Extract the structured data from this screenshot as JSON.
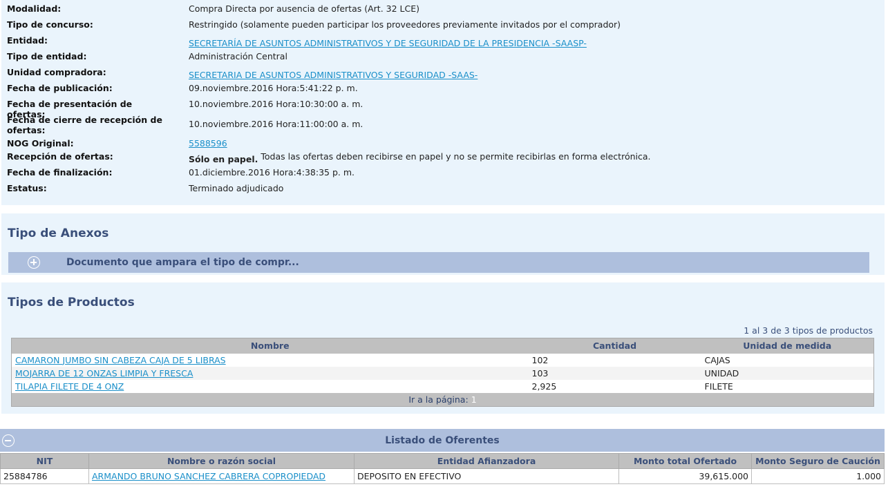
{
  "details": {
    "modalidad_label": "Modalidad:",
    "modalidad_value": "Compra Directa por ausencia de ofertas (Art. 32 LCE)",
    "tipo_concurso_label": "Tipo de concurso:",
    "tipo_concurso_value": "Restringido (solamente pueden participar los proveedores previamente invitados por el comprador)",
    "entidad_label": "Entidad:",
    "entidad_value": "SECRETARÍA DE ASUNTOS ADMINISTRATIVOS Y DE SEGURIDAD DE LA PRESIDENCIA -SAASP-",
    "tipo_entidad_label": "Tipo de entidad:",
    "tipo_entidad_value": "Administración Central",
    "unidad_label": "Unidad compradora:",
    "unidad_value": "SECRETARIA DE ASUNTOS ADMINISTRATIVOS Y SEGURIDAD -SAAS-",
    "fecha_pub_label": "Fecha de publicación:",
    "fecha_pub_value": "09.noviembre.2016 Hora:5:41:22 p. m.",
    "fecha_pres_label": "Fecha de presentación de ofertas:",
    "fecha_pres_value": "10.noviembre.2016 Hora:10:30:00 a. m.",
    "fecha_cierre_label": "Fecha de cierre de recepción de ofertas:",
    "fecha_cierre_value": "10.noviembre.2016 Hora:11:00:00 a. m.",
    "nog_label": "NOG Original:",
    "nog_value": "5588596",
    "recepcion_label": "Recepción de ofertas:",
    "recepcion_bold": "Sólo en papel.",
    "recepcion_value": "Todas las ofertas deben recibirse en papel y no se permite recibirlas en forma electrónica.",
    "fecha_fin_label": "Fecha de finalización:",
    "fecha_fin_value": "01.diciembre.2016 Hora:4:38:35 p. m.",
    "estatus_label": "Estatus:",
    "estatus_value": "Terminado adjudicado"
  },
  "anexos": {
    "title": "Tipo de Anexos",
    "item_label": "Documento que ampara el tipo de compr...",
    "item_icon": "plus-icon"
  },
  "productos": {
    "title": "Tipos de Productos",
    "count_text": "1 al 3 de 3 tipos de productos",
    "columns": [
      "Nombre",
      "Cantidad",
      "Unidad de medida"
    ],
    "rows": [
      {
        "nombre": "CAMARON JUMBO SIN CABEZA CAJA DE 5 LIBRAS",
        "cantidad": "102",
        "unidad": "CAJAS"
      },
      {
        "nombre": "MOJARRA DE 12 ONZAS LIMPIA Y FRESCA",
        "cantidad": "103",
        "unidad": "UNIDAD"
      },
      {
        "nombre": "TILAPIA FILETE DE 4 ONZ",
        "cantidad": "2,925",
        "unidad": "FILETE"
      }
    ],
    "pager_label": "Ir a la página:",
    "pager_page": "1"
  },
  "oferentes": {
    "title": "Listado de Oferentes",
    "toggle_icon": "minus-icon",
    "columns": [
      "NIT",
      "Nombre o razón social",
      "Entidad Afianzadora",
      "Monto total Ofertado",
      "Monto Seguro de Caución"
    ],
    "rows": [
      {
        "nit": "25884786",
        "nombre": "ARMANDO BRUNO SANCHEZ CABRERA COPROPIEDAD",
        "entidad": "DEPOSITO EN EFECTIVO",
        "monto": "39,615.000",
        "seguro": "1.000"
      }
    ]
  },
  "colors": {
    "panel_bg": "#eaf4fc",
    "accent_bar": "#aebfdd",
    "title_text": "#3a4f7a",
    "link": "#1a8fc9",
    "table_header": "#c0c0c0"
  }
}
